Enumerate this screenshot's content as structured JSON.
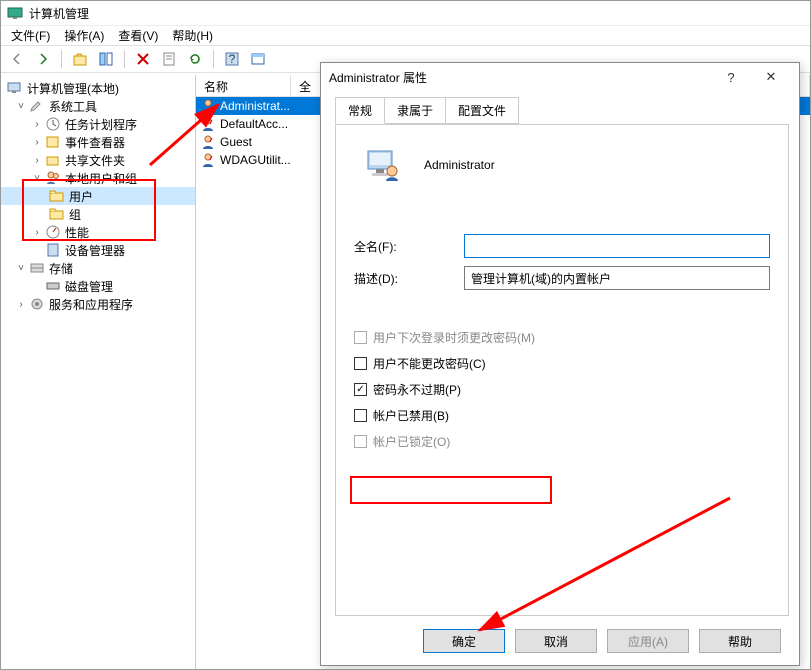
{
  "window": {
    "title": "计算机管理"
  },
  "menu": {
    "file": "文件(F)",
    "action": "操作(A)",
    "view": "查看(V)",
    "help": "帮助(H)"
  },
  "tree": {
    "root": "计算机管理(本地)",
    "systemTools": "系统工具",
    "taskScheduler": "任务计划程序",
    "eventViewer": "事件查看器",
    "sharedFolders": "共享文件夹",
    "localUsersGroups": "本地用户和组",
    "users": "用户",
    "groups": "组",
    "performance": "性能",
    "deviceManager": "设备管理器",
    "storage": "存储",
    "diskMgmt": "磁盘管理",
    "servicesApps": "服务和应用程序"
  },
  "list": {
    "headerName": "名称",
    "headerFull": "全",
    "items": [
      "Administrat...",
      "DefaultAcc...",
      "Guest",
      "WDAGUtilit..."
    ]
  },
  "dialog": {
    "title": "Administrator 属性",
    "tabs": {
      "general": "常规",
      "memberOf": "隶属于",
      "profile": "配置文件"
    },
    "userName": "Administrator",
    "fullNameLabel": "全名(F):",
    "fullNameValue": "",
    "descriptionLabel": "描述(D):",
    "descriptionValue": "管理计算机(域)的内置帐户",
    "mustChange": "用户下次登录时须更改密码(M)",
    "cannotChange": "用户不能更改密码(C)",
    "neverExpires": "密码永不过期(P)",
    "disabled": "帐户已禁用(B)",
    "locked": "帐户已锁定(O)",
    "ok": "确定",
    "cancel": "取消",
    "apply": "应用(A)",
    "help": "帮助"
  }
}
